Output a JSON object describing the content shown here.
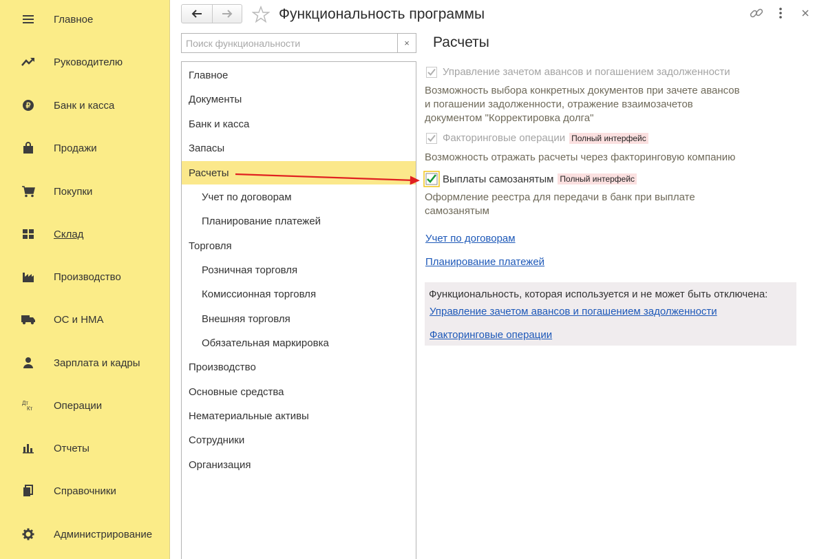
{
  "sidebar": {
    "items": [
      {
        "label": "Главное",
        "icon": "menu-icon"
      },
      {
        "label": "Руководителю",
        "icon": "trend-icon"
      },
      {
        "label": "Банк и касса",
        "icon": "ruble-icon"
      },
      {
        "label": "Продажи",
        "icon": "shopping-bag-icon"
      },
      {
        "label": "Покупки",
        "icon": "cart-icon"
      },
      {
        "label": "Склад",
        "icon": "warehouse-icon"
      },
      {
        "label": "Производство",
        "icon": "factory-icon"
      },
      {
        "label": "ОС и НМА",
        "icon": "truck-icon"
      },
      {
        "label": "Зарплата и кадры",
        "icon": "person-icon"
      },
      {
        "label": "Операции",
        "icon": "dt-kt-icon",
        "icon_text": {
          "top": "Дт",
          "bottom": "Кт"
        }
      },
      {
        "label": "Отчеты",
        "icon": "bar-chart-icon"
      },
      {
        "label": "Справочники",
        "icon": "books-icon"
      },
      {
        "label": "Администрирование",
        "icon": "gear-icon"
      }
    ]
  },
  "header": {
    "title": "Функциональность программы"
  },
  "search": {
    "placeholder": "Поиск функциональности",
    "value": "",
    "clear_label": "×"
  },
  "tree": {
    "items": [
      {
        "label": "Главное",
        "level": 0
      },
      {
        "label": "Документы",
        "level": 0
      },
      {
        "label": "Банк и касса",
        "level": 0
      },
      {
        "label": "Запасы",
        "level": 0
      },
      {
        "label": "Расчеты",
        "level": 0,
        "selected": true
      },
      {
        "label": "Учет по договорам",
        "level": 1
      },
      {
        "label": "Планирование платежей",
        "level": 1
      },
      {
        "label": "Торговля",
        "level": 0
      },
      {
        "label": "Розничная торговля",
        "level": 1
      },
      {
        "label": "Комиссионная торговля",
        "level": 1
      },
      {
        "label": "Внешняя торговля",
        "level": 1
      },
      {
        "label": "Обязательная маркировка",
        "level": 1
      },
      {
        "label": "Производство",
        "level": 0
      },
      {
        "label": "Основные средства",
        "level": 0
      },
      {
        "label": "Нематериальные активы",
        "level": 0
      },
      {
        "label": "Сотрудники",
        "level": 0
      },
      {
        "label": "Организация",
        "level": 0
      }
    ]
  },
  "content": {
    "section_title": "Расчеты",
    "options": [
      {
        "label": "Управление зачетом авансов и погашением задолженности",
        "checked": true,
        "disabled": true,
        "badge": "",
        "description": [
          "Возможность выбора конкретных документов при зачете авансов",
          "и погашении задолженности, отражение взаимозачетов",
          "документом \"Корректировка долга\""
        ]
      },
      {
        "label": "Факторинговые операции",
        "checked": true,
        "disabled": true,
        "badge": "Полный интерфейс",
        "description": [
          "Возможность отражать расчеты через факторинговую компанию"
        ]
      },
      {
        "label": "Выплаты самозанятым",
        "checked": true,
        "disabled": false,
        "badge": "Полный интерфейс",
        "description": [
          "Оформление реестра для передачи в банк при выплате",
          "самозанятым"
        ]
      }
    ],
    "links": [
      "Учет по договорам",
      "Планирование платежей"
    ],
    "enabled_box": {
      "caption": "Функциональность, которая используется и не может быть отключена:",
      "links": [
        "Управление зачетом авансов и погашением задолженности",
        "Факторинговые операции"
      ]
    }
  },
  "colors": {
    "sidebar_bg": "#fbec88",
    "selected_bg": "#fbe88b",
    "link": "#1d58b8",
    "badge_bg": "#fbe0e0",
    "check_green": "#1a9a3a",
    "annotation_arrow": "#e02020"
  }
}
